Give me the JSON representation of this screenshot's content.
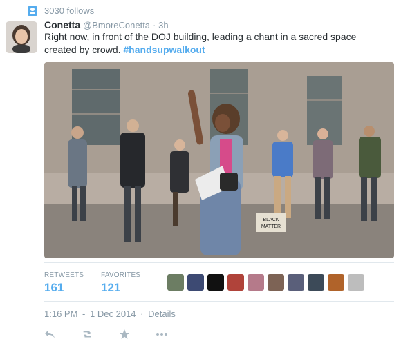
{
  "context": {
    "text": "3030 follows",
    "icon": "follow-user-icon"
  },
  "tweet": {
    "name": "Conetta",
    "handle": "@BmoreConetta",
    "separator": "·",
    "time": "3h",
    "text": "Right now, in front of the DOJ building, leading a chant in a sacred space created by crowd.",
    "hashtag": "#handsupwalkout"
  },
  "stats": {
    "retweets_label": "RETWEETS",
    "retweets_value": "161",
    "favorites_label": "FAVORITES",
    "favorites_value": "121"
  },
  "meta": {
    "time": "1:16 PM",
    "sep1": "-",
    "date": "1 Dec 2014",
    "sep2": "·",
    "details": "Details"
  },
  "actions": [
    "reply-icon",
    "retweet-icon",
    "favorite-icon",
    "more-icon"
  ],
  "colors": {
    "accent": "#55acee",
    "muted": "#8899a6",
    "text": "#292f33"
  }
}
